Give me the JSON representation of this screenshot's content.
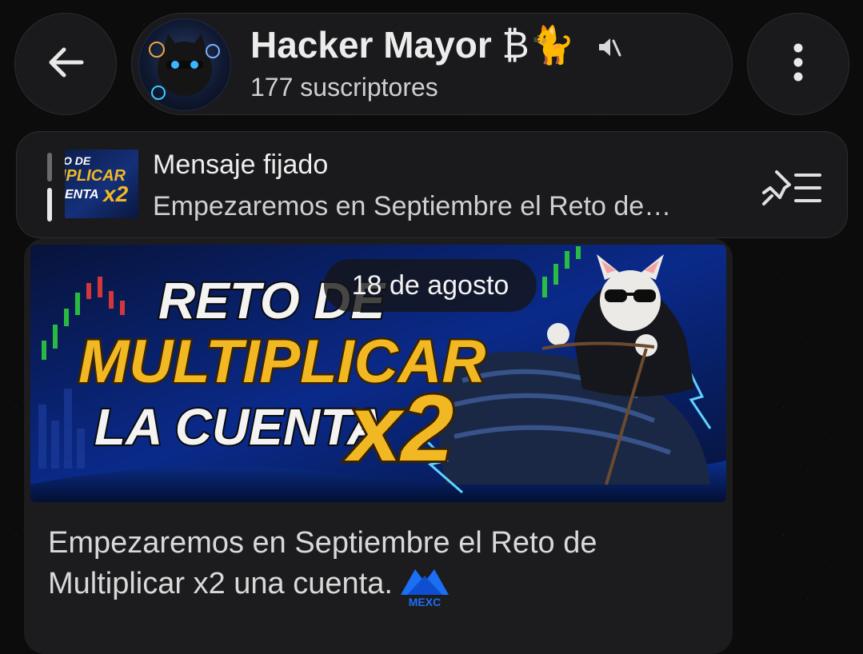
{
  "header": {
    "back_icon": "arrow-left-icon",
    "channel_name": "Hacker Mayor",
    "name_symbols": "₿🐈",
    "subscribers": "177 suscriptores",
    "muted_icon": "speaker-muted-icon",
    "menu_icon": "more-vertical-icon"
  },
  "pinned": {
    "title": "Mensaje fijado",
    "preview": "Empezaremos en Septiembre el Reto de…",
    "thumb_text_1": "O DE",
    "thumb_text_2": "IPLICAR",
    "thumb_text_3": "ENTA",
    "thumb_text_4": "x2",
    "list_icon": "pinned-list-icon"
  },
  "banner": {
    "line1": "RETO DE",
    "line2": "MULTIPLICAR",
    "line3": "LA CUENTA",
    "badge": "x2"
  },
  "date_chip": "18 de agosto",
  "message": {
    "line1": "Empezaremos en Septiembre el Reto de",
    "line2": "Multiplicar x2 una cuenta.",
    "logo_text": "MEXC"
  },
  "colors": {
    "background": "#0c0c0d",
    "surface": "#1c1c1e",
    "banner_blue": "#0a2a8a",
    "gold": "#f2b824",
    "mexc_blue": "#1b6ff5"
  }
}
